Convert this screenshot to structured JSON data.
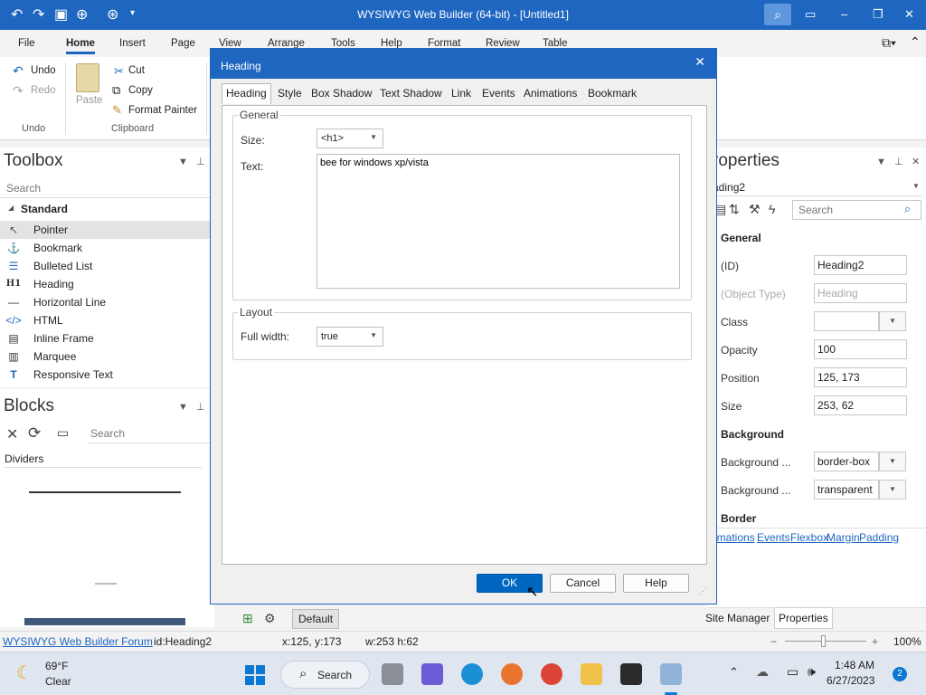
{
  "window": {
    "title": "WYSIWYG Web Builder (64-bit) - [Untitled1]"
  },
  "menu": [
    "File",
    "Home",
    "Insert",
    "Page",
    "View",
    "Arrange",
    "Tools",
    "Help",
    "Format",
    "Review",
    "Table"
  ],
  "ribbon": {
    "undo": "Undo",
    "redo": "Redo",
    "paste": "Paste",
    "cut": "Cut",
    "copy": "Copy",
    "format_painter": "Format Painter",
    "group_undo": "Undo",
    "group_clipboard": "Clipboard"
  },
  "toolbox": {
    "title": "Toolbox",
    "search_placeholder": "Search",
    "category": "Standard",
    "items": [
      "Pointer",
      "Bookmark",
      "Bulleted List",
      "Heading",
      "Horizontal Line",
      "HTML",
      "Inline Frame",
      "Marquee",
      "Responsive Text"
    ]
  },
  "blocks": {
    "title": "Blocks",
    "search_placeholder": "Search",
    "category": "Dividers"
  },
  "properties": {
    "title": "roperties",
    "object": "ading2",
    "search_placeholder": "Search",
    "section_general": "General",
    "section_background": "Background",
    "section_border": "Border",
    "rows": {
      "id_label": "(ID)",
      "id_value": "Heading2",
      "type_label": "(Object Type)",
      "type_value": "Heading",
      "class_label": "Class",
      "class_value": "",
      "opacity_label": "Opacity",
      "opacity_value": "100",
      "position_label": "Position",
      "position_value": "125, 173",
      "size_label": "Size",
      "size_value": "253, 62",
      "bg1_label": "Background ...",
      "bg1_value": "border-box",
      "bg2_label": "Background ...",
      "bg2_value": "transparent"
    },
    "links": [
      "imations",
      "Events",
      "Flexbox",
      "Margin",
      "Padding"
    ],
    "tabs": [
      "Site Manager",
      "Properties"
    ]
  },
  "dialog": {
    "title": "Heading",
    "tabs": [
      "Heading",
      "Style",
      "Box Shadow",
      "Text Shadow",
      "Link",
      "Events",
      "Animations",
      "Bookmark"
    ],
    "group_general": "General",
    "size_label": "Size:",
    "size_value": "<h1>",
    "text_label": "Text:",
    "text_value": "bee for windows xp/vista",
    "group_layout": "Layout",
    "fullwidth_label": "Full width:",
    "fullwidth_value": "true",
    "ok": "OK",
    "cancel": "Cancel",
    "help": "Help"
  },
  "docbar": {
    "page_tab": "Default"
  },
  "status": {
    "forum": "WYSIWYG Web Builder Forum",
    "id": "id:Heading2",
    "coords": "x:125, y:173",
    "size": "w:253 h:62",
    "zoom": "100%"
  },
  "taskbar": {
    "temp": "69°F",
    "weather": "Clear",
    "search": "Search",
    "time": "1:48 AM",
    "date": "6/27/2023",
    "notifications": "2"
  }
}
